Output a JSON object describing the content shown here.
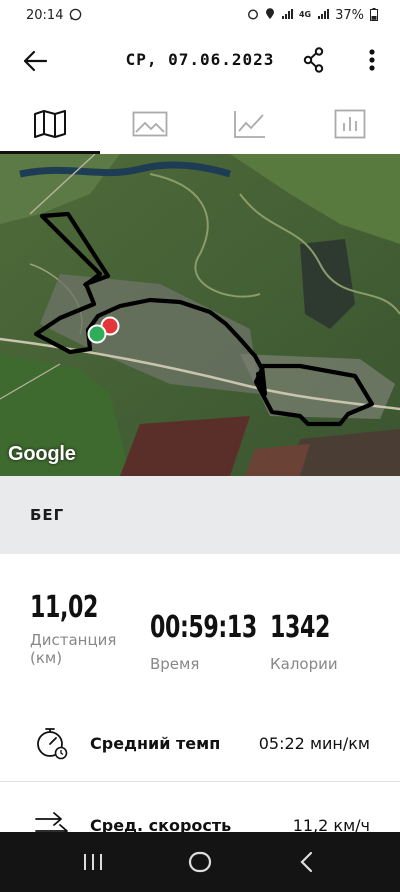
{
  "status_bar": {
    "time": "20:14",
    "network": "4G",
    "battery": "37%"
  },
  "header": {
    "title": "СР, 07.06.2023"
  },
  "tabs": [
    {
      "name": "map",
      "icon": "map-icon",
      "active": true
    },
    {
      "name": "photos",
      "icon": "image-icon",
      "active": false
    },
    {
      "name": "chart",
      "icon": "line-chart-icon",
      "active": false
    },
    {
      "name": "splits",
      "icon": "bar-chart-icon",
      "active": false
    }
  ],
  "map": {
    "attribution": "Google",
    "route_color": "#000000",
    "start_marker_color": "#2fae5a",
    "end_marker_color": "#e2363c"
  },
  "activity": {
    "type": "БЕГ"
  },
  "stats": {
    "distance_value": "11,02",
    "distance_label_1": "Дистанция",
    "distance_label_2": "(км)",
    "time_value": "00:59:13",
    "time_label": "Время",
    "calories_value": "1342",
    "calories_label": "Калории"
  },
  "details": {
    "pace_label": "Средний темп",
    "pace_value": "05:22 мин/км",
    "speed_label": "Сред. скорость",
    "speed_value": "11,2 км/ч"
  }
}
